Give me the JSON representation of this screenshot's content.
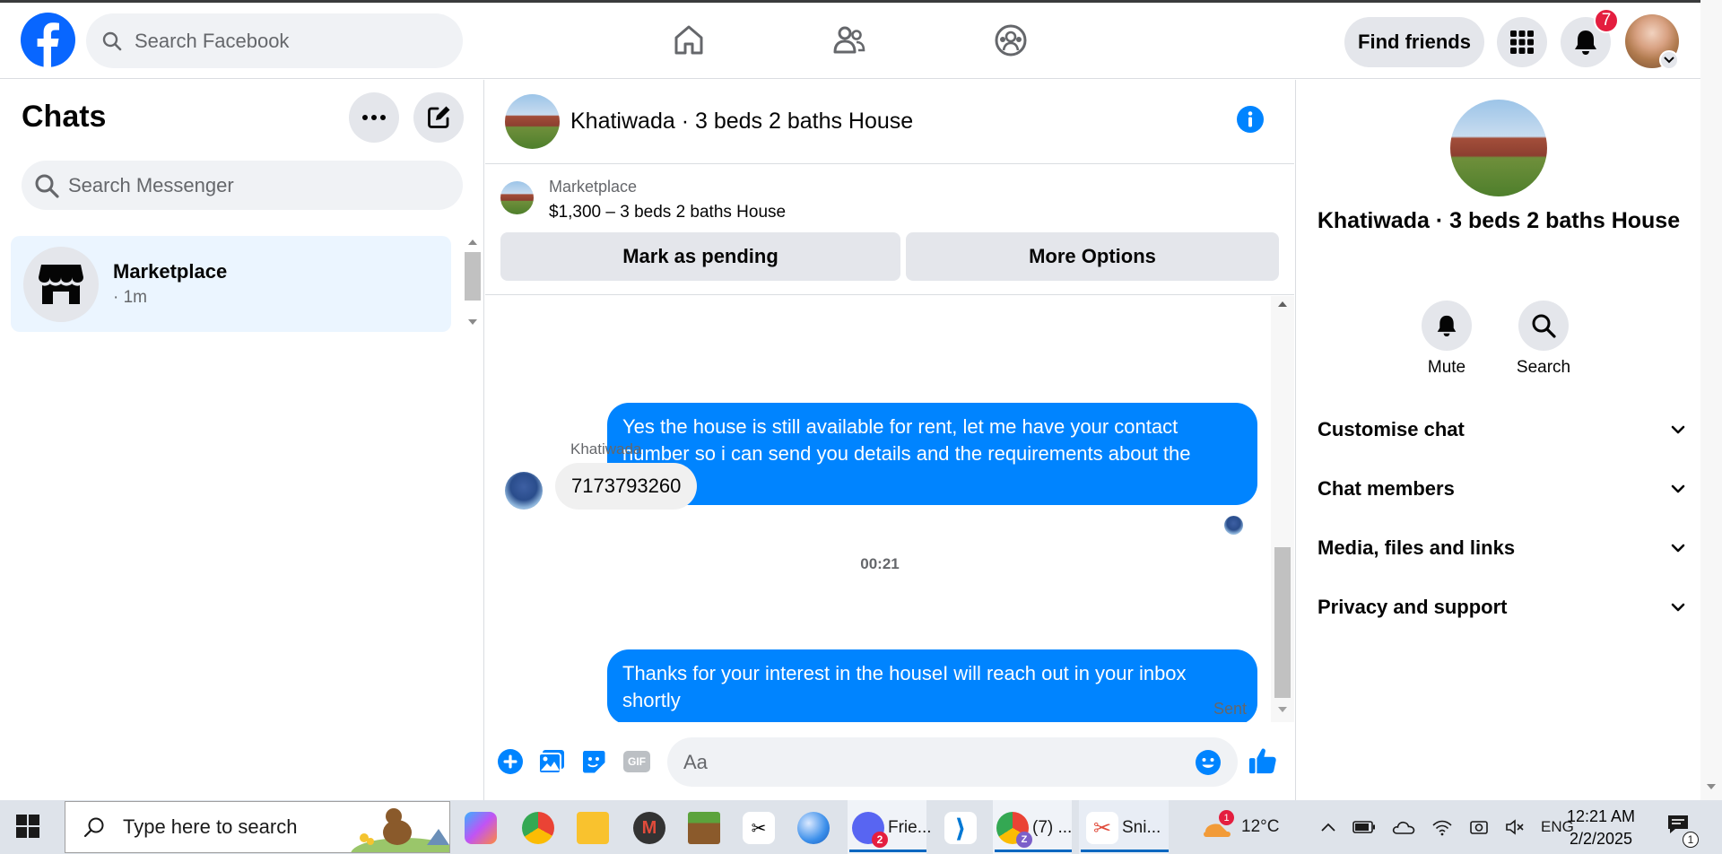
{
  "topnav": {
    "search_placeholder": "Search Facebook",
    "find_friends": "Find friends",
    "notification_count": "7"
  },
  "left": {
    "title": "Chats",
    "search_placeholder": "Search Messenger",
    "chats": [
      {
        "name": "Marketplace",
        "time": "· 1m"
      }
    ]
  },
  "conversation": {
    "title": "Khatiwada · 3 beds 2 baths House",
    "marketplace_label": "Marketplace",
    "listing": "$1,300 – 3 beds 2 baths House",
    "mark_pending": "Mark as pending",
    "more_options": "More Options",
    "messages": [
      {
        "from": "me",
        "text": "Yes the house is still available for rent, let me have your contact number so i can send you details and the requirements about the house."
      },
      {
        "from": "Khatiwada",
        "sender_label": "Khatiwada",
        "text": "7173793260"
      },
      {
        "from": "me",
        "text": "Thanks for your interest in the houseI will reach out in your inbox shortly"
      }
    ],
    "timestamp": "00:21",
    "sent_label": "Sent",
    "composer_placeholder": "Aa",
    "gif_label": "GIF"
  },
  "right": {
    "title": "Khatiwada · 3 beds 2 baths House",
    "mute": "Mute",
    "search": "Search",
    "sections": [
      "Customise chat",
      "Chat members",
      "Media, files and links",
      "Privacy and support"
    ]
  },
  "taskbar": {
    "search_placeholder": "Type here to search",
    "apps": [
      {
        "name": "Frie...",
        "badge": "2"
      },
      {
        "name": "(7) ...",
        "badge": "Z"
      },
      {
        "name": "Sni..."
      }
    ],
    "weather_badge": "1",
    "temperature": "12°C",
    "language": "ENG",
    "time": "12:21 AM",
    "date": "2/2/2025",
    "notification_badge": "1"
  },
  "colors": {
    "brand": "#0866ff",
    "bubble_out": "#0084ff",
    "selected_chat": "#ebf5ff",
    "badge": "#e41e3f"
  }
}
